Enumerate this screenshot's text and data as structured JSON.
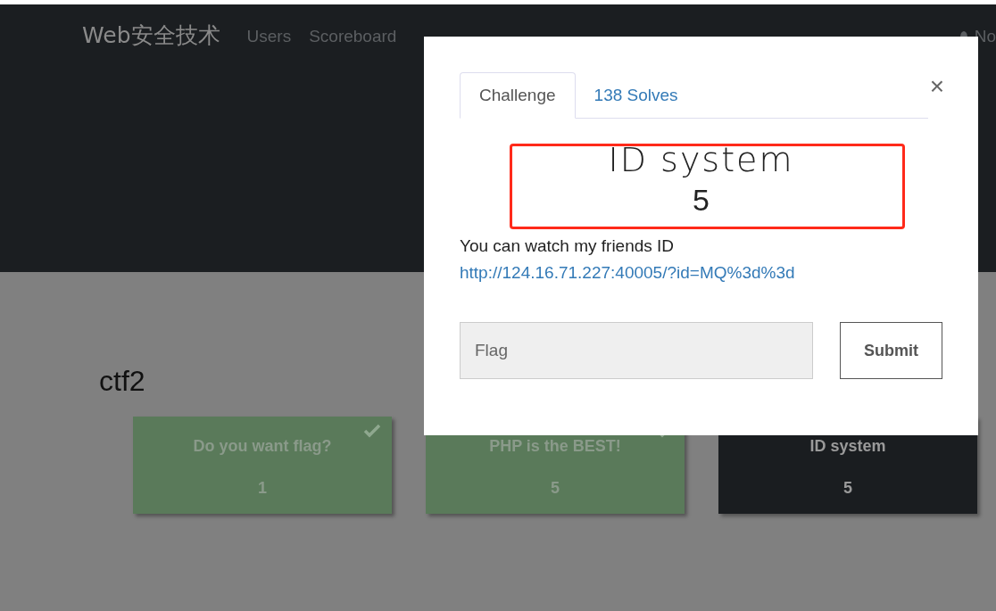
{
  "navbar": {
    "brand": "Web安全技术",
    "links": [
      "Users",
      "Scoreboard"
    ],
    "right_link": "No"
  },
  "category": "ctf2",
  "challenges": [
    {
      "name": "Do you want flag?",
      "value": "1",
      "solved": true
    },
    {
      "name": "PHP is the BEST!",
      "value": "5",
      "solved": true
    },
    {
      "name": "ID system",
      "value": "5",
      "solved": false
    }
  ],
  "modal": {
    "tabs": [
      {
        "label": "Challenge",
        "selected": true
      },
      {
        "label": "138 Solves",
        "selected": false
      }
    ],
    "title": "ID system",
    "value": "5",
    "description": "You can watch my friends ID",
    "link": "http://124.16.71.227:40005/?id=MQ%3d%3d",
    "flag": {
      "placeholder": "Flag"
    },
    "submit": "Submit",
    "close": "×"
  }
}
